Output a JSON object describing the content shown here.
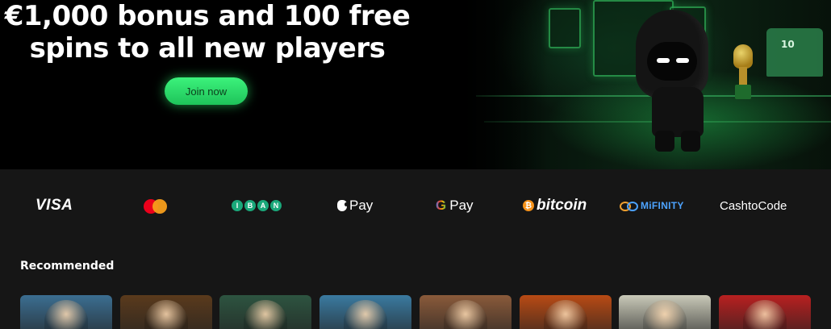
{
  "hero": {
    "title_line1": "€1,000 bonus and 100 free",
    "title_line2": "spins to all new players",
    "join_label": "Join now",
    "jersey_number": "10"
  },
  "payments": {
    "visa": "VISA",
    "iban_letters": [
      "I",
      "B",
      "A",
      "N"
    ],
    "apple_pay": "Pay",
    "google_g": "G",
    "google_pay": "Pay",
    "bitcoin_symbol": "₿",
    "bitcoin": "bitcoin",
    "mifinity": "MiFINITY",
    "cashtocode": "CashtoCode"
  },
  "recommended": {
    "title": "Recommended",
    "games": [
      {
        "icon": "boy-character-thumbnail",
        "bg": "#3b6e91"
      },
      {
        "icon": "adventurer-thumbnail",
        "bg": "#5a3a1c"
      },
      {
        "icon": "footballer-thumbnail",
        "bg": "#2d5440"
      },
      {
        "icon": "raccoon-pirate-thumbnail",
        "bg": "#3a7aa0"
      },
      {
        "icon": "cowboy-thumbnail",
        "bg": "#8a5a3a"
      },
      {
        "icon": "golden-warrior-thumbnail",
        "bg": "#b84a14"
      },
      {
        "icon": "businessman-thumbnail",
        "bg": "#c9c9b8"
      },
      {
        "icon": "chicken-thumbnail",
        "bg": "#b82020"
      }
    ]
  }
}
